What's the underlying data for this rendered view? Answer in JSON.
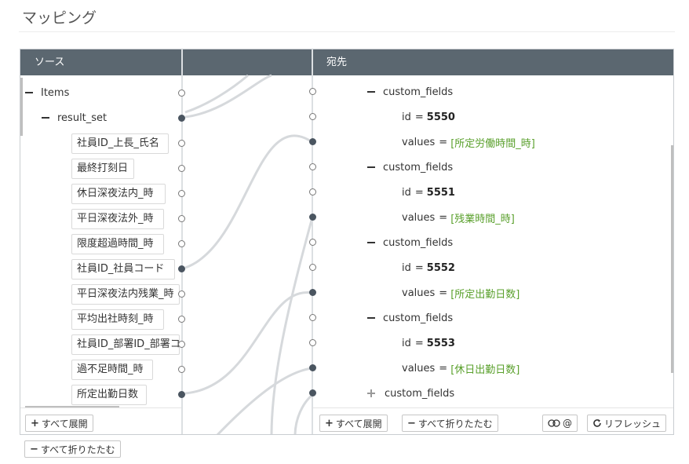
{
  "page": {
    "title": "マッピング"
  },
  "source": {
    "header": "ソース",
    "root": {
      "label": "Items"
    },
    "result_set": {
      "label": "result_set"
    },
    "fields": [
      "社員ID_上長_氏名",
      "最終打刻日",
      "休日深夜法内_時",
      "平日深夜法外_時",
      "限度超過時間_時",
      "社員ID_社員コード",
      "平日深夜法内残業_時",
      "平均出社時刻_時",
      "社員ID_部署ID_部署コ",
      "過不足時間_時",
      "所定出勤日数"
    ],
    "expand_all": "すべて展開",
    "collapse_all": "すべて折りたたむ"
  },
  "dest": {
    "header": "宛先",
    "groups": [
      {
        "name": "custom_fields",
        "id_key": "id",
        "id_value": "5550",
        "values_key": "values",
        "values_value": "[所定労働時間_時]"
      },
      {
        "name": "custom_fields",
        "id_key": "id",
        "id_value": "5551",
        "values_key": "values",
        "values_value": "[残業時間_時]"
      },
      {
        "name": "custom_fields",
        "id_key": "id",
        "id_value": "5552",
        "values_key": "values",
        "values_value": "[所定出勤日数]"
      },
      {
        "name": "custom_fields",
        "id_key": "id",
        "id_value": "5553",
        "values_key": "values",
        "values_value": "[休日出勤日数]"
      }
    ],
    "collapsed_group": "custom_fields",
    "eq": "=",
    "expand_all": "すべて展開",
    "collapse_all": "すべて折りたたむ",
    "toggle_label": "@",
    "refresh": "リフレッシュ"
  }
}
